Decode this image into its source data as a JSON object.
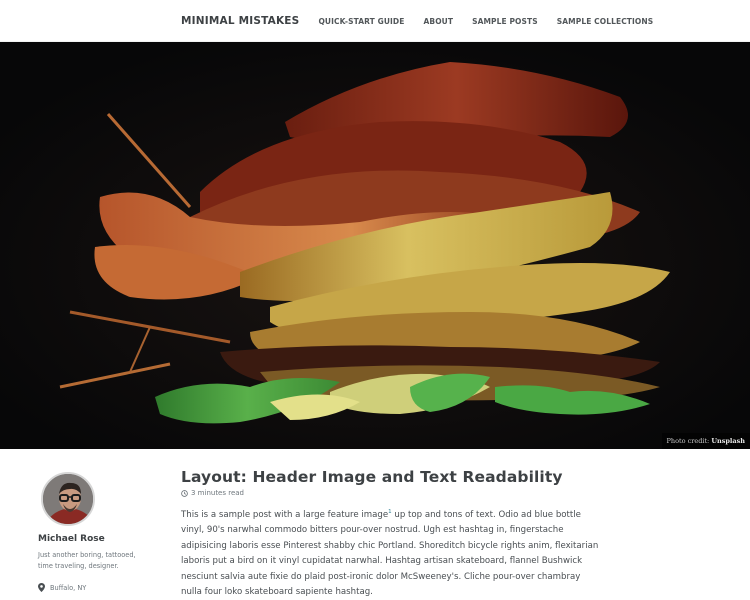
{
  "nav": {
    "site_title": "MINIMAL MISTAKES",
    "links": [
      "QUICK-START GUIDE",
      "ABOUT",
      "SAMPLE POSTS",
      "SAMPLE COLLECTIONS"
    ]
  },
  "hero": {
    "credit_prefix": "Photo credit:",
    "credit_source": "Unsplash"
  },
  "author": {
    "name": "Michael Rose",
    "bio_lines": [
      "Just another boring, tattooed,",
      "time traveling, designer."
    ],
    "location": "Buffalo, NY",
    "avatar_icon": "avatar-photo",
    "location_icon": "map-marker-icon"
  },
  "post": {
    "title": "Layout: Header Image and Text Readability",
    "read_time": "3 minutes read",
    "read_time_icon": "clock-icon",
    "footnote_ref": "1",
    "body_lines": [
      {
        "text": "This is a sample post with a large feature image",
        "sup": "1",
        "after": " up top and tons of text. Odio ad blue bottle"
      },
      {
        "text": "vinyl, 90's narwhal commodo bitters pour-over nostrud. Ugh est hashtag in, fingerstache"
      },
      {
        "text": "adipisicing laboris esse Pinterest shabby chic Portland. Shoreditch bicycle rights anim, flexitarian"
      },
      {
        "text": "laboris put a bird on it vinyl cupidatat narwhal. Hashtag artisan skateboard, flannel Bushwick"
      },
      {
        "text": "nesciunt salvia aute fixie do plaid post-ironic dolor McSweeney's. Cliche pour-over chambray"
      },
      {
        "text": "nulla four loko skateboard sapiente hashtag."
      }
    ]
  },
  "colors": {
    "accent_link": "#2f7f93",
    "text": "#494e52",
    "heading": "#3d4144",
    "hero_bg": "#0b0b0c"
  }
}
